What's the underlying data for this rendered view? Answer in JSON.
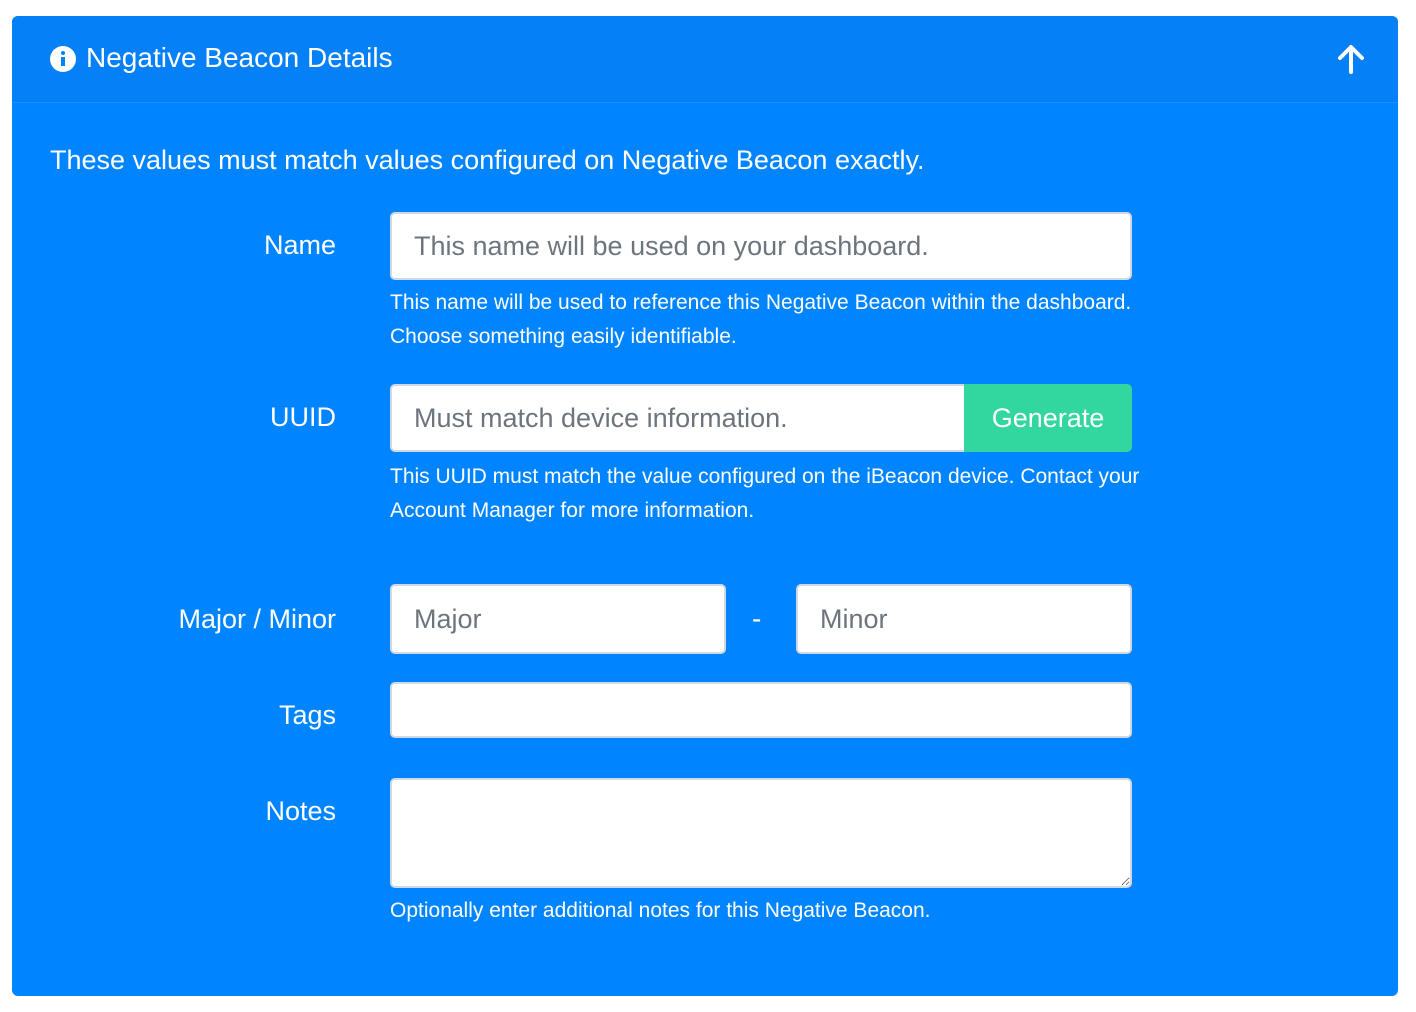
{
  "header": {
    "title": "Negative Beacon Details",
    "info_icon": "info-circle-icon",
    "collapse_icon": "arrow-up-icon"
  },
  "intro_text": "These values must match values configured on Negative Beacon exactly.",
  "form": {
    "name": {
      "label": "Name",
      "placeholder": "This name will be used on your dashboard.",
      "value": "",
      "help": "This name will be used to reference this Negative Beacon within the dashboard. Choose something easily identifiable."
    },
    "uuid": {
      "label": "UUID",
      "placeholder": "Must match device information.",
      "value": "",
      "button_label": "Generate",
      "help": "This UUID must match the value configured on the iBeacon device. Contact your Account Manager for more information."
    },
    "major_minor": {
      "label": "Major / Minor",
      "major_placeholder": "Major",
      "minor_placeholder": "Minor",
      "separator": "-"
    },
    "tags": {
      "label": "Tags",
      "value": ""
    },
    "notes": {
      "label": "Notes",
      "value": "",
      "help": "Optionally enter additional notes for this Negative Beacon."
    }
  },
  "colors": {
    "panel_bg": "#0084ff",
    "header_bg": "#0580f7",
    "button_bg": "#32d69f",
    "text": "#ffffff"
  }
}
